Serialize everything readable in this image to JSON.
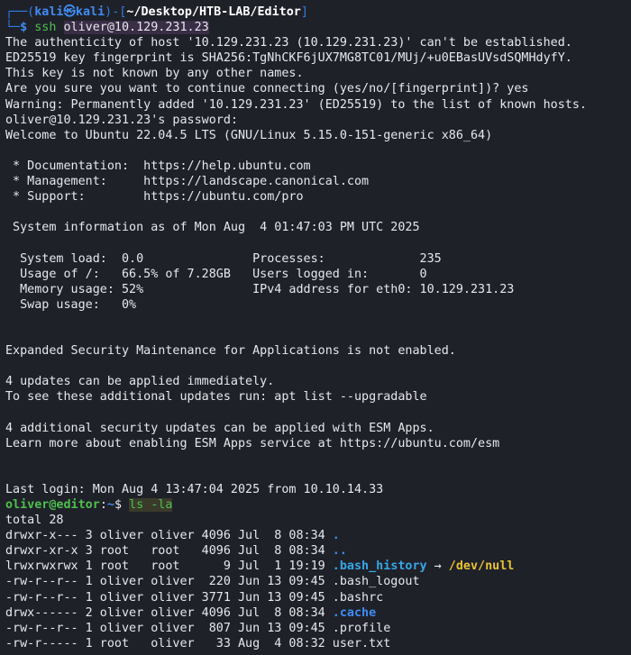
{
  "prompt_kali": {
    "frame_top": "┌──(",
    "user_host": "kali㉿kali",
    "mid": ")-[",
    "path": "~/Desktop/HTB-LAB/Editor",
    "end": "]",
    "frame_bottom": "└─",
    "dollar": "$",
    "command": "ssh",
    "argument": "oliver@10.129.231.23"
  },
  "ssh_output": [
    "The authenticity of host '10.129.231.23 (10.129.231.23)' can't be established.",
    "ED25519 key fingerprint is SHA256:TgNhCKF6jUX7MG8TC01/MUj/+u0EBasUVsdSQMHdyfY.",
    "This key is not known by any other names.",
    "Are you sure you want to continue connecting (yes/no/[fingerprint])? yes",
    "Warning: Permanently added '10.129.231.23' (ED25519) to the list of known hosts.",
    "oliver@10.129.231.23's password:",
    "Welcome to Ubuntu 22.04.5 LTS (GNU/Linux 5.15.0-151-generic x86_64)",
    "",
    " * Documentation:  https://help.ubuntu.com",
    " * Management:     https://landscape.canonical.com",
    " * Support:        https://ubuntu.com/pro",
    "",
    " System information as of Mon Aug  4 01:47:03 PM UTC 2025",
    "",
    "  System load:  0.0               Processes:             235",
    "  Usage of /:   66.5% of 7.28GB   Users logged in:       0",
    "  Memory usage: 52%               IPv4 address for eth0: 10.129.231.23",
    "  Swap usage:   0%",
    "",
    "",
    "Expanded Security Maintenance for Applications is not enabled.",
    "",
    "4 updates can be applied immediately.",
    "To see these additional updates run: apt list --upgradable",
    "",
    "4 additional security updates can be applied with ESM Apps.",
    "Learn more about enabling ESM Apps service at https://ubuntu.com/esm",
    "",
    "",
    "Last login: Mon Aug 4 13:47:04 2025 from 10.10.14.33"
  ],
  "prompt_remote": {
    "user_host": "oliver@editor",
    "sep": ":",
    "path": "~",
    "dollar": "$",
    "command": "ls -la"
  },
  "ls_total": "total 28",
  "ls_rows": [
    {
      "meta": "drwxr-x--- 3 oliver oliver 4096 Jul  8 08:34 ",
      "name": ".",
      "arrow": "",
      "target": ""
    },
    {
      "meta": "drwxr-xr-x 3 root   root   4096 Jul  8 08:34 ",
      "name": "..",
      "arrow": "",
      "target": ""
    },
    {
      "meta": "lrwxrwxrwx 1 root   root      9 Jul  1 19:19 ",
      "name": ".bash_history",
      "arrow": " → ",
      "target": "/dev/null"
    },
    {
      "meta": "-rw-r--r-- 1 oliver oliver  220 Jun 13 09:45 ",
      "name": ".bash_logout",
      "arrow": "",
      "target": ""
    },
    {
      "meta": "-rw-r--r-- 1 oliver oliver 3771 Jun 13 09:45 ",
      "name": ".bashrc",
      "arrow": "",
      "target": ""
    },
    {
      "meta": "drwx------ 2 oliver oliver 4096 Jul  8 08:34 ",
      "name": ".cache",
      "arrow": "",
      "target": ""
    },
    {
      "meta": "-rw-r--r-- 1 oliver oliver  807 Jun 13 09:45 ",
      "name": ".profile",
      "arrow": "",
      "target": ""
    },
    {
      "meta": "-rw-r----- 1 root   oliver   33 Aug  4 08:32 ",
      "name": "user.txt",
      "arrow": "",
      "target": ""
    }
  ],
  "colors": {
    "background": "#1f2129",
    "foreground": "#e6e8ec",
    "prompt_blue": "#3f8cf2",
    "command_green": "#4ec04e",
    "link_cyan": "#35a7e8",
    "symlink_target_yellow": "#e8c233"
  }
}
